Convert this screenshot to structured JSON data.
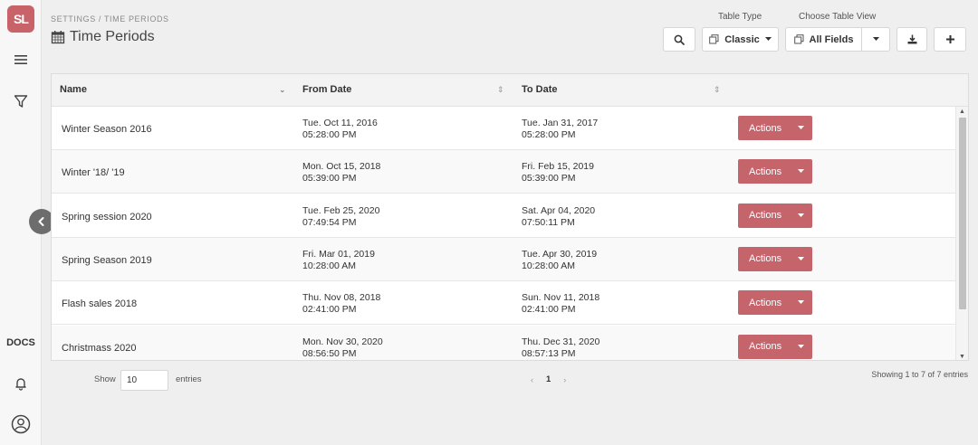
{
  "sidebar": {
    "logo": "SL",
    "docs_label": "DOCS",
    "icons": [
      "menu-icon",
      "filter-icon",
      "bell-icon",
      "user-icon"
    ]
  },
  "header": {
    "breadcrumb": "SETTINGS / TIME PERIODS",
    "title": "Time Periods",
    "table_type_label": "Table Type",
    "table_view_label": "Choose Table View",
    "table_type_value": "Classic",
    "table_view_value": "All Fields"
  },
  "table": {
    "columns": [
      "Name",
      "From Date",
      "To Date"
    ],
    "action_label": "Actions",
    "rows": [
      {
        "name": "Winter Season 2016",
        "from_date": "Tue. Oct 11, 2016",
        "from_time": "05:28:00 PM",
        "to_date": "Tue. Jan 31, 2017",
        "to_time": "05:28:00 PM"
      },
      {
        "name": "Winter '18/ '19",
        "from_date": "Mon. Oct 15, 2018",
        "from_time": "05:39:00 PM",
        "to_date": "Fri. Feb 15, 2019",
        "to_time": "05:39:00 PM"
      },
      {
        "name": "Spring session 2020",
        "from_date": "Tue. Feb 25, 2020",
        "from_time": "07:49:54 PM",
        "to_date": "Sat. Apr 04, 2020",
        "to_time": "07:50:11 PM"
      },
      {
        "name": "Spring Season 2019",
        "from_date": "Fri. Mar 01, 2019",
        "from_time": "10:28:00 AM",
        "to_date": "Tue. Apr 30, 2019",
        "to_time": "10:28:00 AM"
      },
      {
        "name": "Flash sales 2018",
        "from_date": "Thu. Nov 08, 2018",
        "from_time": "02:41:00 PM",
        "to_date": "Sun. Nov 11, 2018",
        "to_time": "02:41:00 PM"
      },
      {
        "name": "Christmass 2020",
        "from_date": "Mon. Nov 30, 2020",
        "from_time": "08:56:50 PM",
        "to_date": "Thu. Dec 31, 2020",
        "to_time": "08:57:13 PM"
      }
    ]
  },
  "footer": {
    "show_label": "Show",
    "entries_value": "10",
    "entries_label": "entries",
    "current_page": "1",
    "showing_text": "Showing 1 to 7 of 7 entries"
  },
  "colors": {
    "accent": "#c6646c",
    "logo": "#c9636a"
  }
}
